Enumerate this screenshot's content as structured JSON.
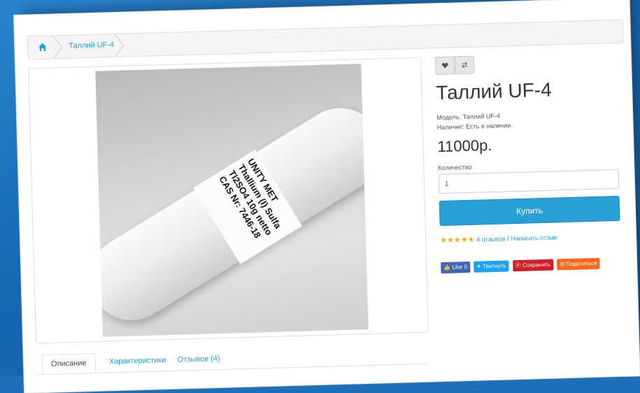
{
  "breadcrumb": {
    "home_icon": "home-icon",
    "current": "Таллий UF-4"
  },
  "product": {
    "title": "Таллий UF-4",
    "model_label": "Модель:",
    "model_value": "Таллий UF-4",
    "availability_label": "Наличие:",
    "availability_value": "Есть в наличии",
    "price": "11000р.",
    "quantity_label": "Количество",
    "quantity_value": "1",
    "buy_label": "Купить",
    "wishlist_icon": "heart-icon",
    "compare_icon": "compare-icon"
  },
  "rating": {
    "stars": 5,
    "reviews_link": "4 отзывов",
    "separator": "/",
    "write_review": "Написать отзыв",
    "star_color": "#f0ad1e"
  },
  "photo": {
    "label_line1": "UNITY MET",
    "label_line2": "Thallium (I) Sulfa",
    "label_line3": "Tl2SO4 10g netto",
    "label_line4": "CAS Nr: 7446-18"
  },
  "share": {
    "like": "Like 0",
    "tweet": "Твитнуть",
    "save": "Сохранить",
    "share": "Поделиться"
  },
  "tabs": [
    {
      "label": "Описание"
    },
    {
      "label": "Характеристики"
    },
    {
      "label": "Отзывов (4)"
    }
  ],
  "colors": {
    "accent": "#2a9fd6",
    "link": "#23a1d1",
    "background": "#1e6fb8"
  }
}
